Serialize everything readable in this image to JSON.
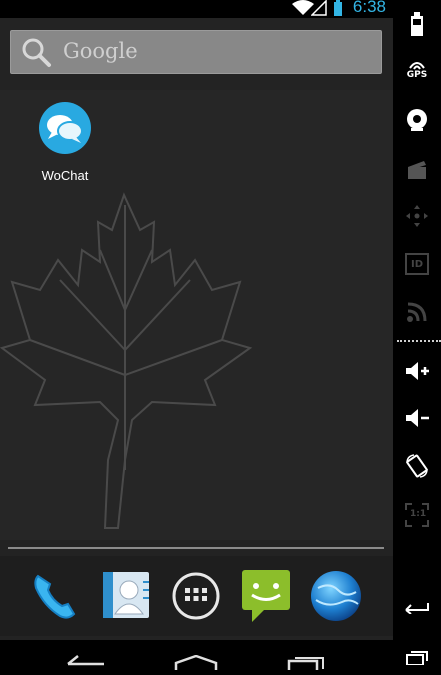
{
  "status_bar": {
    "time": "6:38"
  },
  "search": {
    "placeholder": "Google"
  },
  "apps": [
    {
      "label": "WoChat",
      "icon": "chat-bubbles-icon"
    }
  ],
  "dock": {
    "items": [
      {
        "icon": "phone-icon",
        "name": "Phone"
      },
      {
        "icon": "contacts-icon",
        "name": "Contacts"
      },
      {
        "icon": "all-apps-icon",
        "name": "All apps"
      },
      {
        "icon": "messaging-icon",
        "name": "Messaging"
      },
      {
        "icon": "browser-globe-icon",
        "name": "Browser"
      }
    ]
  },
  "navigation": {
    "buttons": [
      "back-icon",
      "home-icon",
      "recent-apps-icon"
    ]
  },
  "controls": {
    "gps_label": "GPS",
    "id_label": "ID",
    "scale_label": "1:1",
    "items": [
      "battery-icon",
      "gps-icon",
      "camera-icon",
      "media-icon",
      "dpad-icon",
      "id-icon",
      "network-icon",
      "volume-up-icon",
      "volume-down-icon",
      "rotate-icon",
      "scale-icon",
      "back-icon",
      "recent-apps-icon"
    ]
  },
  "colors": {
    "accent": "#33b5e5",
    "screen_bg": "#232323",
    "wochat_blue": "#29a9e1",
    "messaging_green": "#8cbe2b"
  }
}
